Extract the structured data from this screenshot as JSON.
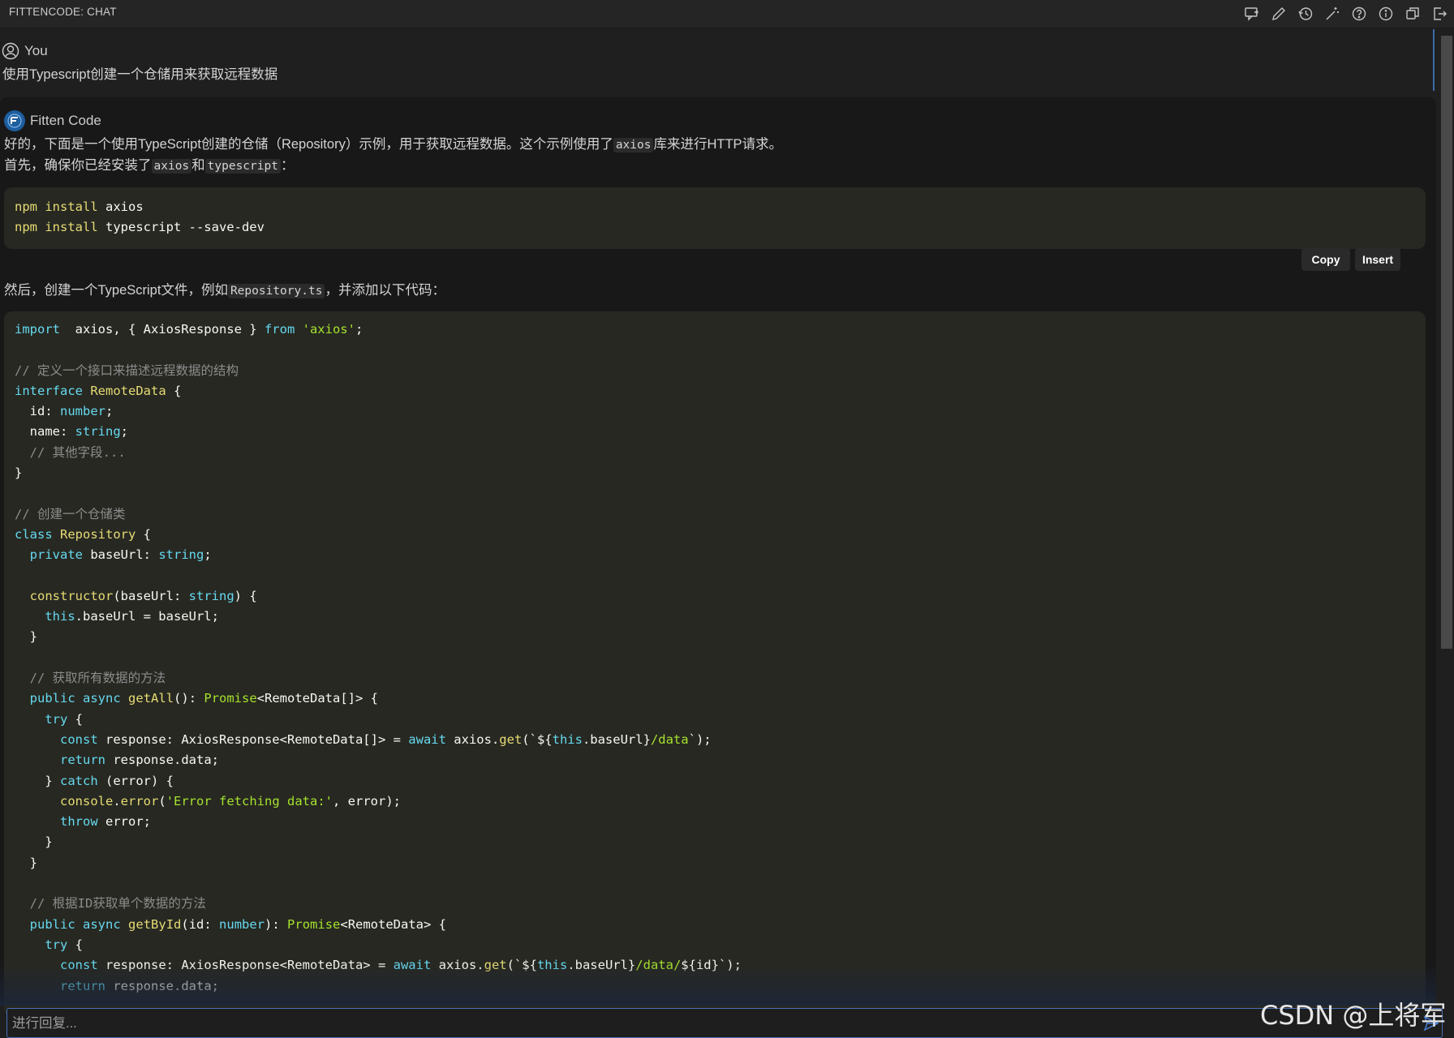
{
  "topbar": {
    "title": "FITTENCODE: CHAT",
    "icons": [
      "new-chat-icon",
      "edit-icon",
      "history-icon",
      "magic-wand-icon",
      "help-icon",
      "info-icon",
      "copy-window-icon",
      "logout-icon"
    ]
  },
  "user_message": {
    "author": "You",
    "text": "使用Typescript创建一个仓储用来获取远程数据"
  },
  "ai_message": {
    "author": "Fitten Code",
    "para1_pre": "好的，下面是一个使用TypeScript创建的仓储（Repository）示例，用于获取远程数据。这个示例使用了",
    "para1_code": "axios",
    "para1_post": "库来进行HTTP请求。",
    "para2_pre": "首先，确保你已经安装了",
    "para2_code1": "axios",
    "para2_mid": "和",
    "para2_code2": "typescript",
    "para2_post": "：",
    "code1": {
      "line1_cmd": "npm install",
      "line1_arg": " axios",
      "line2_cmd": "npm install",
      "line2_arg": " typescript --save-dev"
    },
    "copy_label": "Copy",
    "insert_label": "Insert",
    "para3_pre": "然后，创建一个TypeScript文件，例如",
    "para3_code": "Repository.ts",
    "para3_post": "，并添加以下代码："
  },
  "code2_lines": [
    [
      [
        "kw",
        "import"
      ],
      [
        "",
        "  axios, { AxiosResponse } "
      ],
      [
        "kw",
        "from"
      ],
      [
        "",
        " "
      ],
      [
        "st",
        "'axios'"
      ],
      [
        "",
        ";"
      ]
    ],
    [],
    [
      [
        "cm",
        "// 定义一个接口来描述远程数据的结构"
      ]
    ],
    [
      [
        "kw",
        "interface"
      ],
      [
        "",
        " "
      ],
      [
        "ty",
        "RemoteData"
      ],
      [
        "",
        " {"
      ]
    ],
    [
      [
        "",
        "  id: "
      ],
      [
        "kw",
        "number"
      ],
      [
        "",
        ";"
      ]
    ],
    [
      [
        "",
        "  name: "
      ],
      [
        "kw",
        "string"
      ],
      [
        "",
        ";"
      ]
    ],
    [
      [
        "cm",
        "  // 其他字段..."
      ]
    ],
    [
      [
        "",
        "}"
      ]
    ],
    [],
    [
      [
        "cm",
        "// 创建一个仓储类"
      ]
    ],
    [
      [
        "kw",
        "class"
      ],
      [
        "",
        " "
      ],
      [
        "ty",
        "Repository"
      ],
      [
        "",
        " {"
      ]
    ],
    [
      [
        "",
        "  "
      ],
      [
        "kw",
        "private"
      ],
      [
        "",
        " baseUrl: "
      ],
      [
        "kw",
        "string"
      ],
      [
        "",
        ";"
      ]
    ],
    [],
    [
      [
        "",
        "  "
      ],
      [
        "fn",
        "constructor"
      ],
      [
        "",
        "(baseUrl: "
      ],
      [
        "kw",
        "string"
      ],
      [
        "",
        ") {"
      ]
    ],
    [
      [
        "",
        "    "
      ],
      [
        "kw",
        "this"
      ],
      [
        "",
        ".baseUrl = baseUrl;"
      ]
    ],
    [
      [
        "",
        "  }"
      ]
    ],
    [],
    [
      [
        "cm",
        "  // 获取所有数据的方法"
      ]
    ],
    [
      [
        "",
        "  "
      ],
      [
        "kw",
        "public"
      ],
      [
        "",
        " "
      ],
      [
        "kw",
        "async"
      ],
      [
        "",
        " "
      ],
      [
        "fn",
        "getAll"
      ],
      [
        "",
        "(): "
      ],
      [
        "st",
        "Promise"
      ],
      [
        "",
        "<RemoteData[]> {"
      ]
    ],
    [
      [
        "",
        "    "
      ],
      [
        "kw",
        "try"
      ],
      [
        "",
        " {"
      ]
    ],
    [
      [
        "",
        "      "
      ],
      [
        "kw",
        "const"
      ],
      [
        "",
        " response: AxiosResponse<RemoteData[]> = "
      ],
      [
        "kw",
        "await"
      ],
      [
        "",
        " axios."
      ],
      [
        "fn",
        "get"
      ],
      [
        "",
        "(`${"
      ],
      [
        "kw",
        "this"
      ],
      [
        "",
        ".baseUrl}"
      ],
      [
        "st",
        "/data"
      ],
      [
        "",
        "`);"
      ]
    ],
    [
      [
        "",
        "      "
      ],
      [
        "kw",
        "return"
      ],
      [
        "",
        " response.data;"
      ]
    ],
    [
      [
        "",
        "    } "
      ],
      [
        "kw",
        "catch"
      ],
      [
        "",
        " (error) {"
      ]
    ],
    [
      [
        "",
        "      "
      ],
      [
        "fn",
        "console"
      ],
      [
        "",
        "."
      ],
      [
        "fn",
        "error"
      ],
      [
        "",
        "("
      ],
      [
        "st",
        "'Error fetching data:'"
      ],
      [
        "",
        ", error);"
      ]
    ],
    [
      [
        "",
        "      "
      ],
      [
        "kw",
        "throw"
      ],
      [
        "",
        " error;"
      ]
    ],
    [
      [
        "",
        "    }"
      ]
    ],
    [
      [
        "",
        "  }"
      ]
    ],
    [],
    [
      [
        "cm",
        "  // 根据ID获取单个数据的方法"
      ]
    ],
    [
      [
        "",
        "  "
      ],
      [
        "kw",
        "public"
      ],
      [
        "",
        " "
      ],
      [
        "kw",
        "async"
      ],
      [
        "",
        " "
      ],
      [
        "fn",
        "getById"
      ],
      [
        "",
        "(id: "
      ],
      [
        "kw",
        "number"
      ],
      [
        "",
        "): "
      ],
      [
        "st",
        "Promise"
      ],
      [
        "",
        "<RemoteData> {"
      ]
    ],
    [
      [
        "",
        "    "
      ],
      [
        "kw",
        "try"
      ],
      [
        "",
        " {"
      ]
    ],
    [
      [
        "",
        "      "
      ],
      [
        "kw",
        "const"
      ],
      [
        "",
        " response: AxiosResponse<RemoteData> = "
      ],
      [
        "kw",
        "await"
      ],
      [
        "",
        " axios."
      ],
      [
        "fn",
        "get"
      ],
      [
        "",
        "(`${"
      ],
      [
        "kw",
        "this"
      ],
      [
        "",
        ".baseUrl}"
      ],
      [
        "st",
        "/data/"
      ],
      [
        "",
        "${id}`);"
      ]
    ],
    [
      [
        "",
        "      "
      ],
      [
        "kw",
        "return"
      ],
      [
        "",
        " response.data;"
      ]
    ]
  ],
  "input": {
    "placeholder": "进行回复..."
  },
  "watermark": "CSDN @上将军"
}
